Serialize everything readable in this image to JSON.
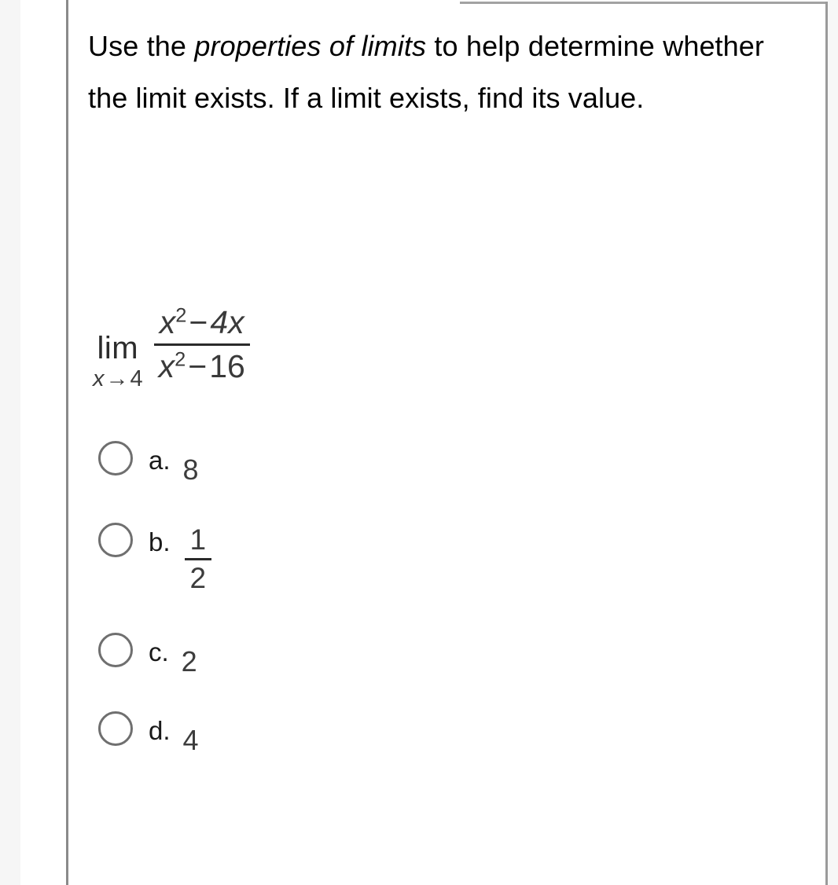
{
  "question": {
    "prompt_parts": [
      {
        "text": "Use the ",
        "style": "normal"
      },
      {
        "text": "properties of limits",
        "style": "italic"
      },
      {
        "text": " to help determine whether the limit exists.  If a limit exists, find its value.",
        "style": "normal"
      }
    ],
    "prompt_lead": "Use the ",
    "prompt_emphasis": "properties of limits",
    "prompt_tail": " to help determine whether the limit exists.  If a limit exists, find its value.",
    "expression": {
      "operator": "lim",
      "subscript_variable": "x",
      "subscript_arrow": "→",
      "subscript_target": "4",
      "numerator": {
        "base": "x",
        "exponent": "2",
        "operator": "−",
        "term": "4x"
      },
      "denominator": {
        "base": "x",
        "exponent": "2",
        "operator": "−",
        "term": "16"
      },
      "plain": "lim x→4 (x² − 4x)/(x² − 16)"
    },
    "options": [
      {
        "letter": "a.",
        "value": "8",
        "kind": "scalar",
        "selected": false
      },
      {
        "letter": "b.",
        "numerator": "1",
        "denominator": "2",
        "kind": "fraction",
        "selected": false
      },
      {
        "letter": "c.",
        "value": "2",
        "kind": "scalar",
        "selected": false
      },
      {
        "letter": "d.",
        "value": "4",
        "kind": "scalar",
        "selected": false
      }
    ]
  },
  "colors": {
    "page_background": "#ffffff",
    "gutter_band": "#f6f6f6",
    "rule_gray": "#8a8a8a",
    "text_black": "#000000",
    "math_gray": "#3a3a3a",
    "radio_border": "#6f6f6f"
  }
}
